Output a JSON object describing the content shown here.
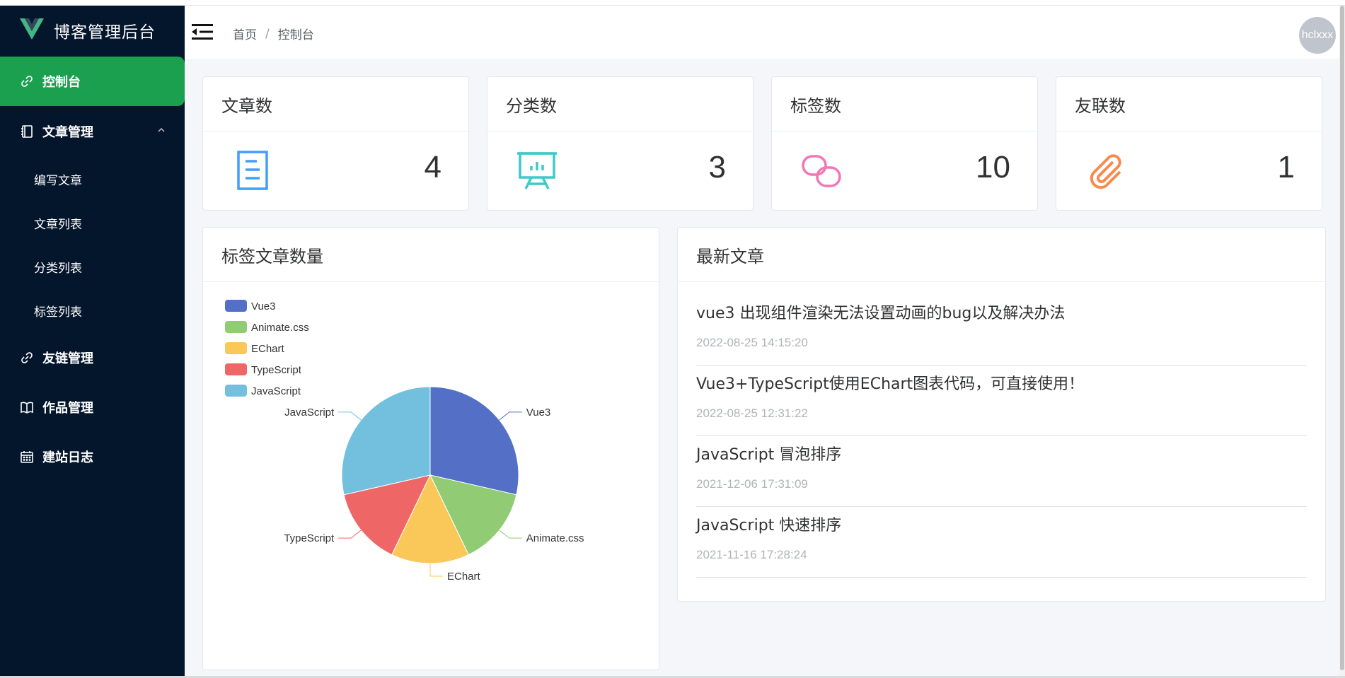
{
  "sidebar": {
    "brand_title": "博客管理后台",
    "items": [
      {
        "label": "控制台",
        "icon": "link-icon"
      },
      {
        "label": "文章管理",
        "icon": "notebook-icon"
      },
      {
        "label": "友链管理",
        "icon": "link-icon"
      },
      {
        "label": "作品管理",
        "icon": "book-icon"
      },
      {
        "label": "建站日志",
        "icon": "calendar-icon"
      }
    ],
    "sub_items": [
      "编写文章",
      "文章列表",
      "分类列表",
      "标签列表"
    ]
  },
  "header": {
    "breadcrumb": [
      "首页",
      "控制台"
    ],
    "breadcrumb_separator": "/",
    "avatar_text": "hclxxx"
  },
  "stats": [
    {
      "title": "文章数",
      "value": "4",
      "icon": "document-icon",
      "color": "#409eff"
    },
    {
      "title": "分类数",
      "value": "3",
      "icon": "presentation-icon",
      "color": "#40c9c6"
    },
    {
      "title": "标签数",
      "value": "10",
      "icon": "chain-icon",
      "color": "#f4516c"
    },
    {
      "title": "友联数",
      "value": "1",
      "icon": "paperclip-icon",
      "color": "#f78b4d"
    }
  ],
  "chart_card": {
    "title": "标签文章数量"
  },
  "chart_data": {
    "type": "pie",
    "categories": [
      "Vue3",
      "Animate.css",
      "EChart",
      "TypeScript",
      "JavaScript"
    ],
    "values": [
      2,
      1,
      1,
      1,
      2
    ],
    "colors": [
      "#5470c6",
      "#91cc75",
      "#fac858",
      "#ee6666",
      "#73c0de"
    ],
    "legend_position": "top-left"
  },
  "news_card": {
    "title": "最新文章",
    "items": [
      {
        "title": "vue3 出现组件渲染无法设置动画的bug以及解决办法",
        "date": "2022-08-25 14:15:20"
      },
      {
        "title": "Vue3+TypeScript使用EChart图表代码，可直接使用！",
        "date": "2022-08-25 12:31:22"
      },
      {
        "title": "JavaScript 冒泡排序",
        "date": "2021-12-06 17:31:09"
      },
      {
        "title": "JavaScript 快速排序",
        "date": "2021-11-16 17:28:24"
      }
    ]
  }
}
